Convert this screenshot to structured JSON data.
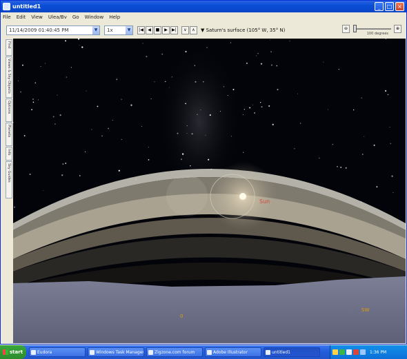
{
  "window": {
    "title": "untitled1"
  },
  "menu": [
    "File",
    "Edit",
    "View",
    "Ulea/Bv",
    "Go",
    "Window",
    "Help"
  ],
  "toolbar": {
    "date_value": "11/14/2009 01:40:45 PM",
    "rate_value": "1x",
    "viewpoint": "Saturn's surface (105° W, 35° N)",
    "zoom_label": "100 degrees"
  },
  "sidebar": [
    "Find",
    "Views & Sky Objects",
    "Options",
    "Planets",
    "Info",
    "Sky Guides"
  ],
  "viewport": {
    "bright_body_label": "Sun",
    "ground_marker_left": "0",
    "ground_marker_right": "SW"
  },
  "taskbar": {
    "start": "start",
    "tasks": [
      "Eudora",
      "Windows Task Manager",
      "Zigzone.com forum",
      "Adobe Illustrator",
      "untitled1"
    ],
    "clock": "1:36 PM"
  },
  "colors": {
    "titlebar": "#0a4ed6",
    "taskbar": "#245edb",
    "space": "#03040a",
    "ring": "#a69f8e",
    "ground": "#6d6f85"
  }
}
